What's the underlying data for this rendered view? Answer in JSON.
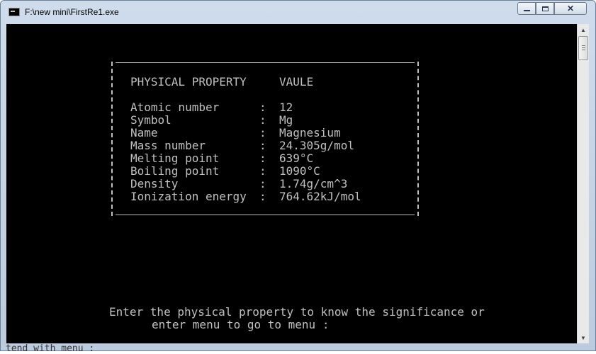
{
  "window": {
    "title": "F:\\new mini\\FirstRe1.exe",
    "close_label": "✕"
  },
  "console": {
    "header": {
      "property": "PHYSICAL PROPERTY",
      "value": "VAULE"
    },
    "rows": [
      {
        "label": "Atomic number",
        "colon": ":",
        "value": "12"
      },
      {
        "label": "Symbol",
        "colon": ":",
        "value": "Mg"
      },
      {
        "label": "Name",
        "colon": ":",
        "value": "Magnesium"
      },
      {
        "label": "Mass number",
        "colon": ":",
        "value": "24.305g/mol"
      },
      {
        "label": "Melting point",
        "colon": ":",
        "value": "639°C"
      },
      {
        "label": "Boiling point",
        "colon": ":",
        "value": "1090°C"
      },
      {
        "label": "Density",
        "colon": ":",
        "value": "1.74g/cm^3"
      },
      {
        "label": "Ionization energy",
        "colon": ":",
        "value": "764.62kJ/mol"
      }
    ],
    "prompt_line1": "Enter the physical property to know the significance or",
    "prompt_line2": "enter menu to go to menu :"
  },
  "background_text": "tend with menu :"
}
